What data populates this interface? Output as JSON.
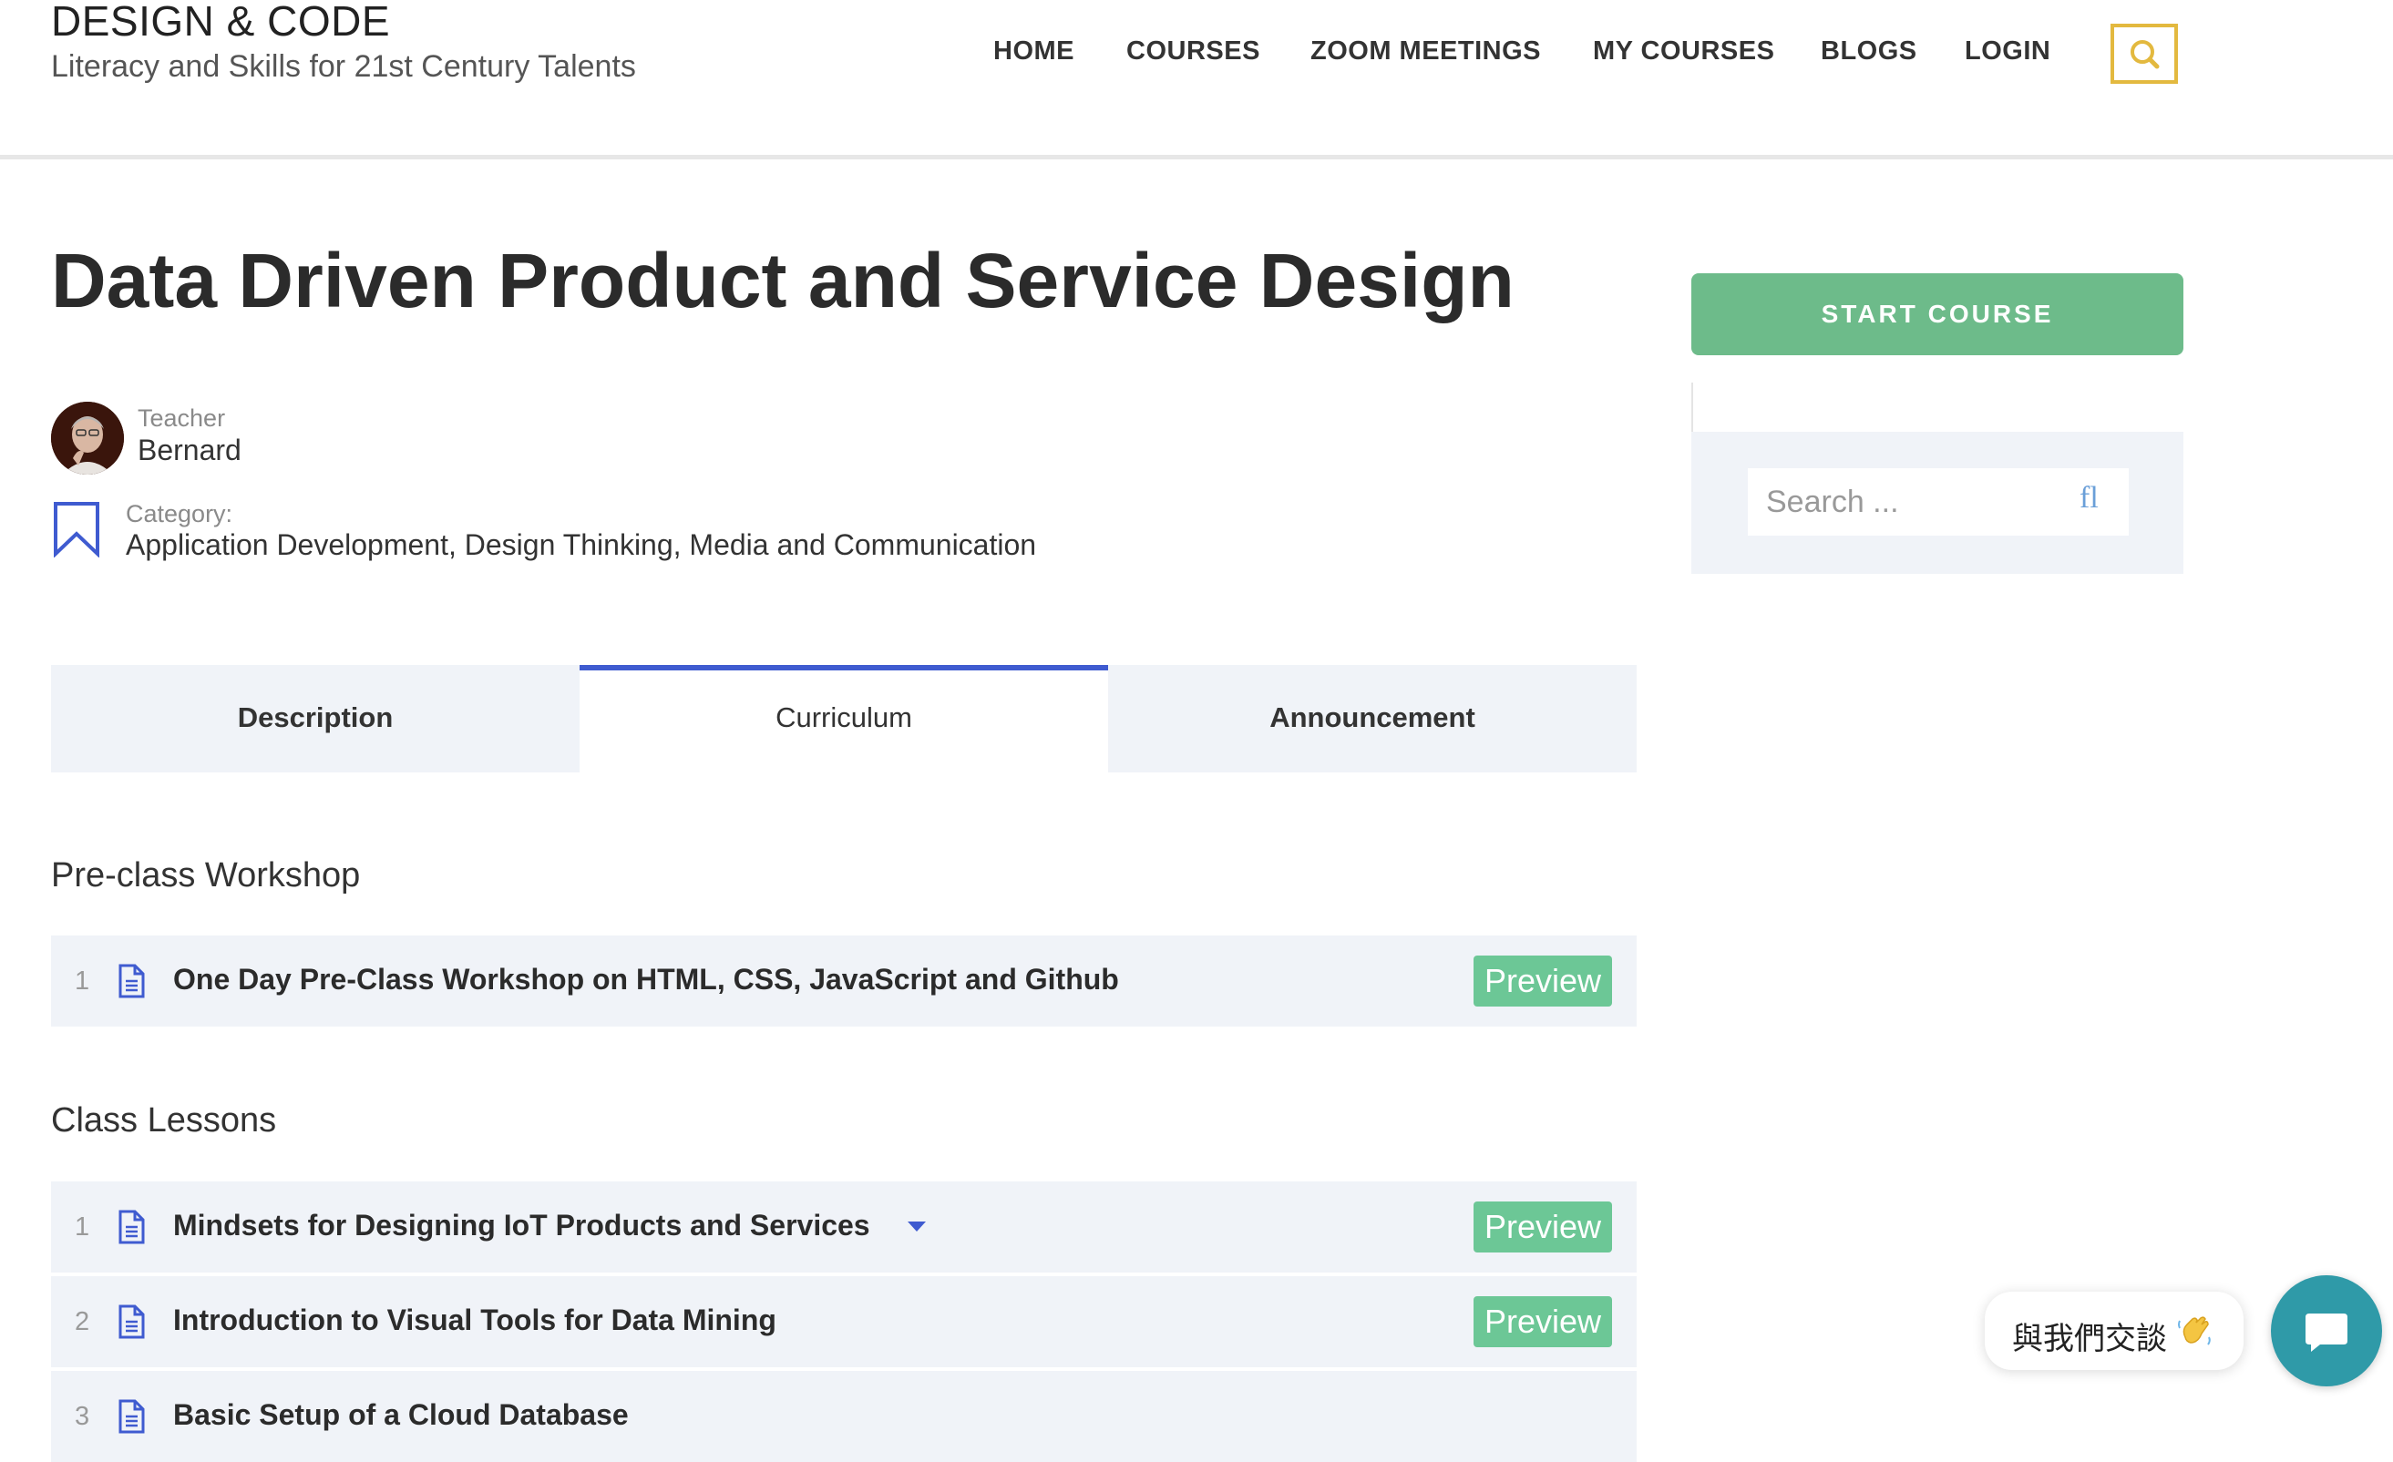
{
  "header": {
    "site_title": "DESIGN & CODE",
    "tagline": "Literacy and Skills for 21st Century Talents",
    "nav": [
      "HOME",
      "COURSES",
      "ZOOM MEETINGS",
      "MY COURSES",
      "BLOGS",
      "LOGIN"
    ],
    "search_icon": "search-icon",
    "accent_color": "#e3b93f"
  },
  "course": {
    "title": "Data Driven Product and Service Design",
    "teacher_label": "Teacher",
    "teacher_name": "Bernard",
    "category_label": "Category:",
    "categories": "Application Development, Design Thinking, Media and Communication"
  },
  "tabs": [
    {
      "label": "Description",
      "active": false
    },
    {
      "label": "Curriculum",
      "active": true
    },
    {
      "label": "Announcement",
      "active": false
    }
  ],
  "curriculum": {
    "sections": [
      {
        "title": "Pre-class Workshop",
        "lessons": [
          {
            "num": "1",
            "title": "One Day Pre-Class Workshop on HTML, CSS, JavaScript and Github",
            "preview": "Preview"
          }
        ]
      },
      {
        "title": "Class Lessons",
        "lessons": [
          {
            "num": "1",
            "title": "Mindsets for Designing IoT Products and Services",
            "preview": "Preview"
          },
          {
            "num": "2",
            "title": "Introduction to Visual Tools for Data Mining",
            "preview": "Preview"
          },
          {
            "num": "3",
            "title": "Basic Setup of a Cloud Database",
            "preview": ""
          }
        ]
      }
    ]
  },
  "sidebar": {
    "start_course": "START COURSE",
    "search_placeholder": "Search ...",
    "search_icon_glyph": "fl"
  },
  "chat": {
    "bubble_text": "與我們交談",
    "launcher_icon": "chat-icon"
  },
  "colors": {
    "primary_blue": "#3f5bd0",
    "preview_green": "#6cc796",
    "start_green": "#6dbb8a",
    "chat_teal": "#2f9aa8"
  }
}
